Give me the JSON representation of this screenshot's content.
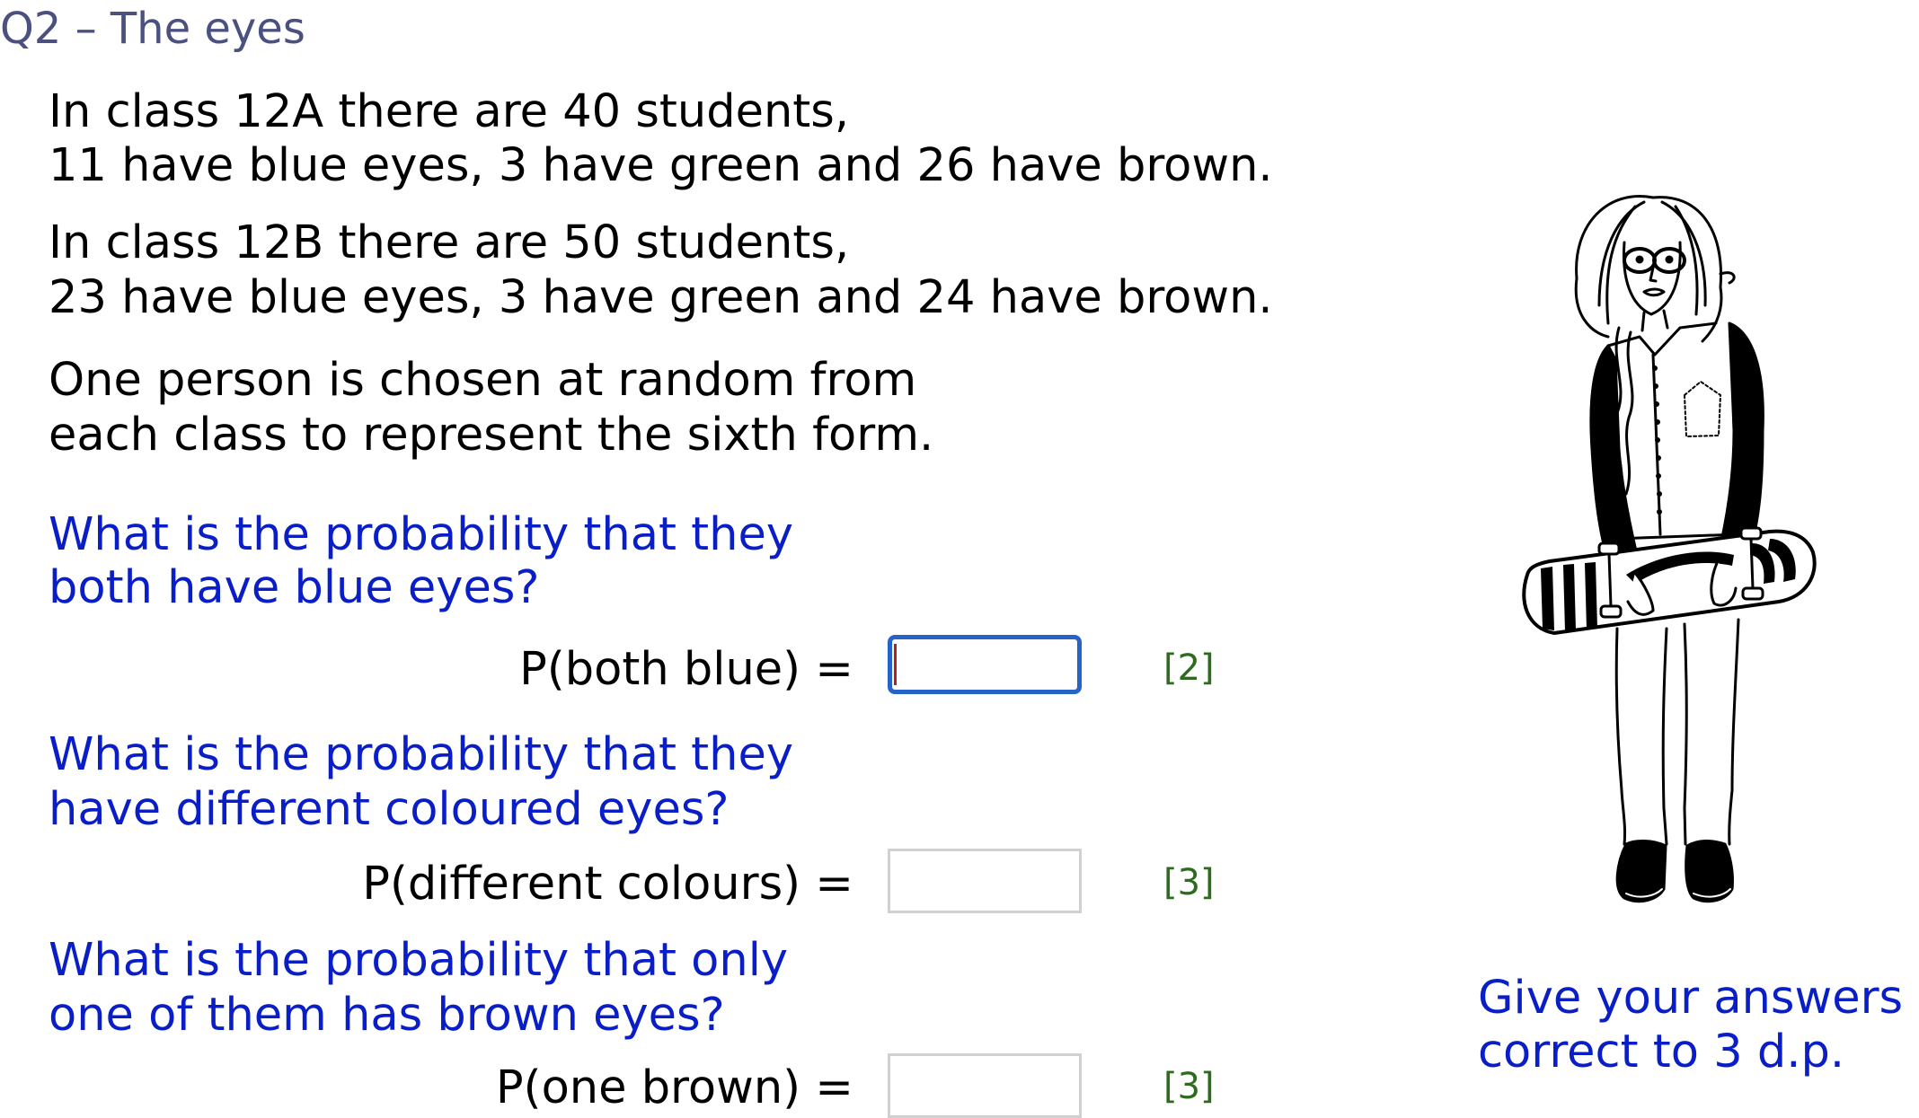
{
  "title": "Q2 – The eyes",
  "intro": {
    "class_a": [
      "In class 12A there are 40 students,",
      "11 have blue eyes, 3 have green and 26 have brown."
    ],
    "class_b": [
      "In class 12B there are 50 students,",
      "23 have blue eyes, 3 have green and 24 have brown."
    ],
    "selection": [
      "One person is chosen at random from",
      "each class to represent the sixth form."
    ]
  },
  "questions": [
    {
      "prompt": [
        "What is the probability that they",
        "both have blue eyes?"
      ],
      "label": "P(both blue) =",
      "value": "",
      "placeholder": "",
      "marks": "[2]",
      "focused": true
    },
    {
      "prompt": [
        "What is the probability that they",
        "have different coloured eyes?"
      ],
      "label": "P(different colours) =",
      "value": "",
      "placeholder": "",
      "marks": "[3]",
      "focused": false
    },
    {
      "prompt": [
        "What is the probability that only",
        "one of them has brown eyes?"
      ],
      "label": "P(one brown) =",
      "value": "",
      "placeholder": "",
      "marks": "[3]",
      "focused": false
    }
  ],
  "note": [
    "Give your answers",
    "correct to 3 d.p."
  ],
  "illustration": {
    "icon": "girl-with-skateboard-illustration"
  },
  "colors": {
    "title": "#4a5080",
    "question": "#0a1ec8",
    "marks": "#2e6b1f",
    "focus_border": "#2563c9",
    "input_border": "#d0d0d0",
    "caret": "#b22222"
  }
}
